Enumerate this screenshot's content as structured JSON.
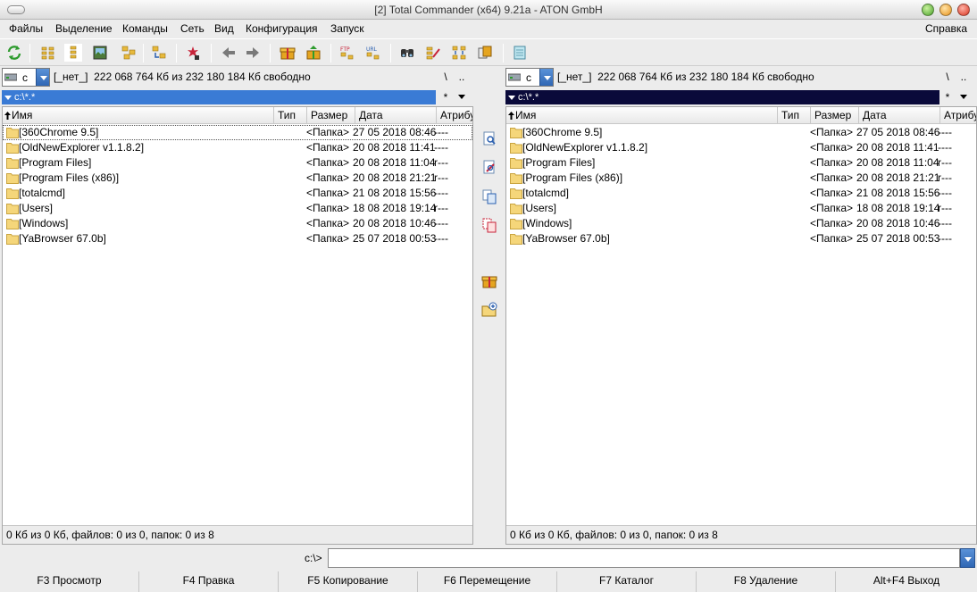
{
  "window": {
    "title": "[2] Total Commander (x64) 9.21a - ATON GmbH"
  },
  "menu": {
    "items": [
      "Файлы",
      "Выделение",
      "Команды",
      "Сеть",
      "Вид",
      "Конфигурация",
      "Запуск"
    ],
    "help": "Справка"
  },
  "toolbar": {
    "buttons": [
      "refresh-icon",
      "brief-view-icon",
      "detailed-view-icon",
      "thumbnails-view-icon",
      "tree-view-icon",
      "compare-dirs-icon",
      "select-icon",
      "back-icon",
      "forward-icon",
      "pack-icon",
      "unpack-icon",
      "ftp-icon",
      "url-icon",
      "search-icon",
      "multi-rename-icon",
      "sync-dirs-icon",
      "copy-names-icon",
      "notepad-icon"
    ]
  },
  "left": {
    "drive": {
      "letter": "c",
      "label": "[_нет_]",
      "info": "222 068 764 Кб из 232 180 184 Кб свободно"
    },
    "path": "c:\\*.*",
    "columns": {
      "name": "Имя",
      "type": "Тип",
      "size": "Размер",
      "date": "Дата",
      "attr": "Атрибу"
    },
    "files": [
      {
        "name": "[360Chrome 9.5]",
        "size": "<Папка>",
        "date": "27 05 2018 08:46",
        "attr": "----"
      },
      {
        "name": "[OldNewExplorer v1.1.8.2]",
        "size": "<Папка>",
        "date": "20 08 2018 11:41",
        "attr": "----"
      },
      {
        "name": "[Program Files]",
        "size": "<Папка>",
        "date": "20 08 2018 11:04",
        "attr": "r---"
      },
      {
        "name": "[Program Files (x86)]",
        "size": "<Папка>",
        "date": "20 08 2018 21:21",
        "attr": "r---"
      },
      {
        "name": "[totalcmd]",
        "size": "<Папка>",
        "date": "21 08 2018 15:56",
        "attr": "----"
      },
      {
        "name": "[Users]",
        "size": "<Папка>",
        "date": "18 08 2018 19:14",
        "attr": "r---"
      },
      {
        "name": "[Windows]",
        "size": "<Папка>",
        "date": "20 08 2018 10:46",
        "attr": "----"
      },
      {
        "name": "[YaBrowser 67.0b]",
        "size": "<Папка>",
        "date": "25 07 2018 00:53",
        "attr": "----"
      }
    ],
    "status": "0 Кб из 0 Кб, файлов: 0 из 0, папок: 0 из 8"
  },
  "right": {
    "drive": {
      "letter": "c",
      "label": "[_нет_]",
      "info": "222 068 764 Кб из 232 180 184 Кб свободно"
    },
    "path": "c:\\*.*",
    "columns": {
      "name": "Имя",
      "type": "Тип",
      "size": "Размер",
      "date": "Дата",
      "attr": "Атрибу"
    },
    "files": [
      {
        "name": "[360Chrome 9.5]",
        "size": "<Папка>",
        "date": "27 05 2018 08:46",
        "attr": "----"
      },
      {
        "name": "[OldNewExplorer v1.1.8.2]",
        "size": "<Папка>",
        "date": "20 08 2018 11:41",
        "attr": "----"
      },
      {
        "name": "[Program Files]",
        "size": "<Папка>",
        "date": "20 08 2018 11:04",
        "attr": "r---"
      },
      {
        "name": "[Program Files (x86)]",
        "size": "<Папка>",
        "date": "20 08 2018 21:21",
        "attr": "r---"
      },
      {
        "name": "[totalcmd]",
        "size": "<Папка>",
        "date": "21 08 2018 15:56",
        "attr": "----"
      },
      {
        "name": "[Users]",
        "size": "<Папка>",
        "date": "18 08 2018 19:14",
        "attr": "r---"
      },
      {
        "name": "[Windows]",
        "size": "<Папка>",
        "date": "20 08 2018 10:46",
        "attr": "----"
      },
      {
        "name": "[YaBrowser 67.0b]",
        "size": "<Папка>",
        "date": "25 07 2018 00:53",
        "attr": "----"
      }
    ],
    "status": "0 Кб из 0 Кб, файлов: 0 из 0, папок: 0 из 8"
  },
  "drive_buttons": {
    "root": "\\",
    "up": ".."
  },
  "path_buttons": {
    "star": "*"
  },
  "cmdline": {
    "prompt": "c:\\>",
    "value": ""
  },
  "fkeys": [
    "F3 Просмотр",
    "F4 Правка",
    "F5 Копирование",
    "F6 Перемещение",
    "F7 Каталог",
    "F8 Удаление",
    "Alt+F4 Выход"
  ],
  "colors": {
    "active_path": "#3a7bd5",
    "inactive_path": "#0a0a3a",
    "folder": "#f5d67a"
  }
}
